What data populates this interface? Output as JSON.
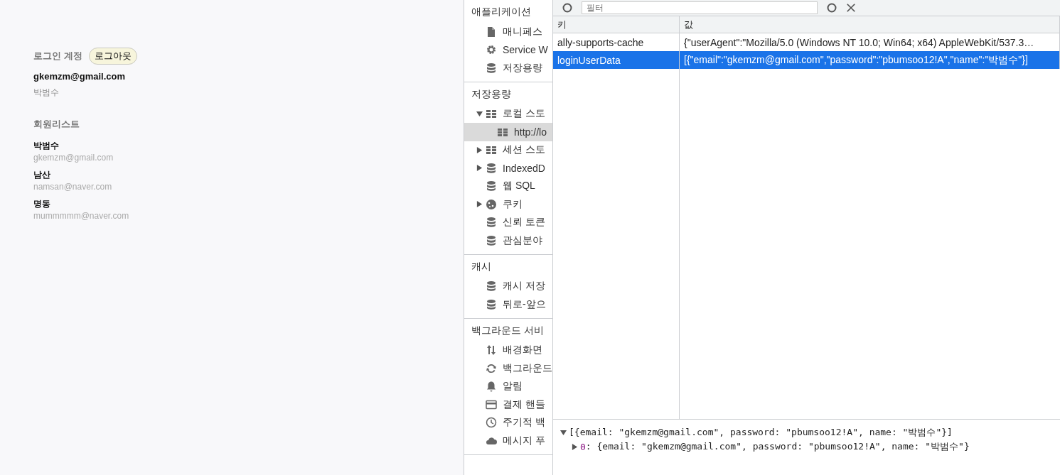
{
  "app": {
    "login_label": "로그인 계정",
    "logout_button": "로그아웃",
    "email": "gkemzm@gmail.com",
    "name": "박범수",
    "members_title": "회원리스트",
    "members": [
      {
        "name": "박범수",
        "email": "gkemzm@gmail.com"
      },
      {
        "name": "남산",
        "email": "namsan@naver.com"
      },
      {
        "name": "명동",
        "email": "mummmmm@naver.com"
      }
    ]
  },
  "devtools": {
    "sidebar": {
      "sections": [
        {
          "title": "애플리케이션",
          "items": [
            {
              "label": "매니페스",
              "kind": "file",
              "selected": false
            },
            {
              "label": "Service W",
              "kind": "gear",
              "selected": false
            },
            {
              "label": "저장용량",
              "kind": "database",
              "selected": false
            }
          ]
        },
        {
          "title": "저장용량",
          "items": [
            {
              "label": "로컬 스토",
              "kind": "grid",
              "selected": false,
              "expanded": true,
              "children": [
                {
                  "label": "http://lo",
                  "kind": "grid",
                  "selected": true
                }
              ]
            },
            {
              "label": "세션 스토",
              "kind": "grid",
              "selected": false,
              "expanded": false
            },
            {
              "label": "IndexedD",
              "kind": "database",
              "selected": false,
              "expanded": false
            },
            {
              "label": "웹 SQL",
              "kind": "database",
              "selected": false
            },
            {
              "label": "쿠키",
              "kind": "cookie",
              "selected": false,
              "expanded": false
            },
            {
              "label": "신뢰 토큰",
              "kind": "database",
              "selected": false
            },
            {
              "label": "관심분야",
              "kind": "database",
              "selected": false
            }
          ]
        },
        {
          "title": "캐시",
          "items": [
            {
              "label": "캐시 저장",
              "kind": "database",
              "selected": false
            },
            {
              "label": "뒤로-앞으",
              "kind": "database",
              "selected": false
            }
          ]
        },
        {
          "title": "백그라운드 서비",
          "items": [
            {
              "label": "배경화면",
              "kind": "arrows",
              "selected": false
            },
            {
              "label": "백그라운드",
              "kind": "sync",
              "selected": false
            },
            {
              "label": "알림",
              "kind": "bell",
              "selected": false
            },
            {
              "label": "결제 핸들",
              "kind": "card",
              "selected": false
            },
            {
              "label": "주기적 백",
              "kind": "clock",
              "selected": false
            },
            {
              "label": "메시지 푸",
              "kind": "cloud",
              "selected": false
            }
          ]
        }
      ]
    },
    "toolbar": {
      "filter_placeholder": "필터"
    },
    "table": {
      "columns": [
        "키",
        "값"
      ],
      "rows": [
        {
          "key": "ally-supports-cache",
          "value": "{\"userAgent\":\"Mozilla/5.0 (Windows NT 10.0; Win64; x64) AppleWebKit/537.3…",
          "selected": false
        },
        {
          "key": "loginUserData",
          "value": "[{\"email\":\"gkemzm@gmail.com\",\"password\":\"pbumsoo12!A\",\"name\":\"박범수\"}]",
          "selected": true
        }
      ]
    },
    "preview": {
      "text": "[{email: \"gkemzm@gmail.com\", password: \"pbumsoo12!A\", name: \"박범수\"}]",
      "expanded": true,
      "children": [
        {
          "index": "0",
          "text": ": {email: \"gkemzm@gmail.com\", password: \"pbumsoo12!A\", name: \"박범수\"}",
          "expanded": false
        }
      ]
    }
  }
}
